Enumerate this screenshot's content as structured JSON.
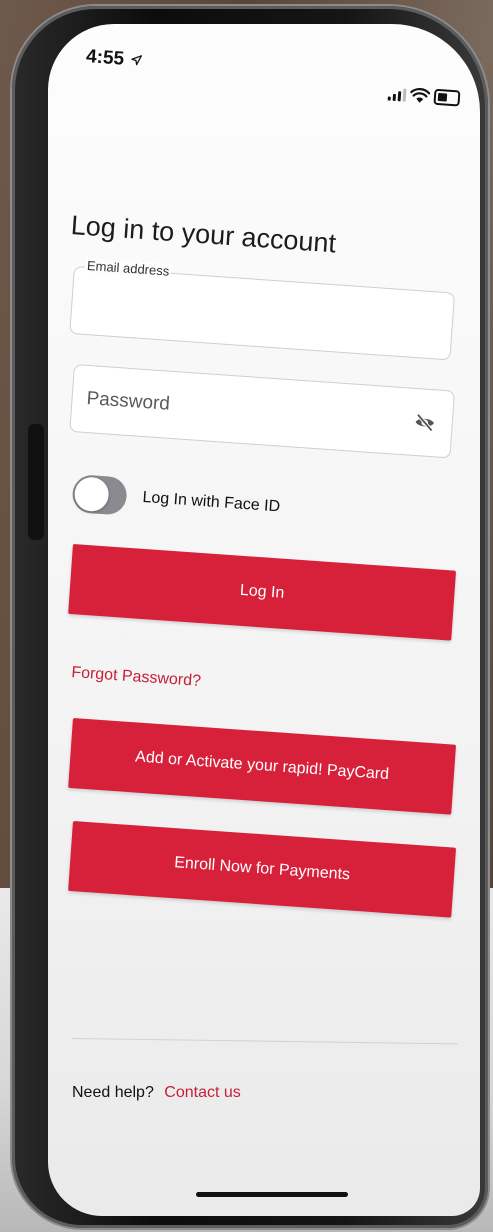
{
  "status_bar": {
    "time": "4:55",
    "icons": [
      "location-arrow-icon",
      "signal-icon",
      "wifi-icon",
      "battery-icon"
    ]
  },
  "login": {
    "title": "Log in to your account",
    "email_label": "Email address",
    "email_value": "",
    "password_placeholder": "Password",
    "password_icon": "eye-off-icon",
    "face_id_label": "Log In with Face ID",
    "face_id_enabled": false,
    "login_button": "Log In",
    "forgot_password": "Forgot Password?"
  },
  "actions": {
    "paycard_button": "Add or Activate your rapid! PayCard",
    "enroll_button": "Enroll Now for Payments"
  },
  "footer": {
    "help_text": "Need help?",
    "contact_link": "Contact us"
  },
  "colors": {
    "brand_red": "#d7213a",
    "link_red": "#c81e36",
    "toggle_off": "#8a8a90"
  }
}
